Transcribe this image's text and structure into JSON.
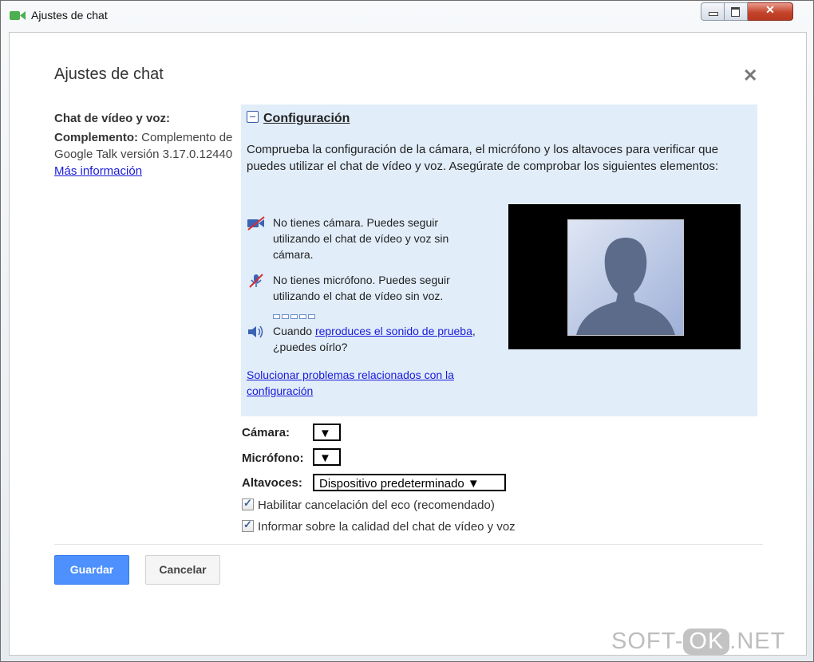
{
  "window": {
    "title": "Ajustes de chat",
    "icon": "video-camera-icon",
    "accent": "#4caf50"
  },
  "dialog": {
    "title": "Ajustes de chat",
    "close_icon": "close-icon"
  },
  "left": {
    "heading": "Chat de vídeo y voz:",
    "plugin_label": "Complemento:",
    "plugin_text": "Complemento de Google Talk versión 3.17.0.12440",
    "more_info_link": "Más información"
  },
  "config": {
    "header": "Configuración",
    "intro": "Comprueba la configuración de la cámara, el micrófono y los altavoces para verificar que puedes utilizar el chat de vídeo y voz. Asegúrate de comprobar los siguientes elementos:",
    "no_camera": "No tienes cámara. Puedes seguir utilizando el chat de vídeo y voz sin cámara.",
    "no_mic": "No tienes micrófono. Puedes seguir utilizando el chat de vídeo sin voz.",
    "sound_before": "Cuando ",
    "sound_link": "reproduces el sonido de prueba",
    "sound_after": ", ¿puedes oírlo?",
    "troubleshoot_link": "Solucionar problemas relacionados con la configuración"
  },
  "devices": {
    "camera_label": "Cámara:",
    "camera_value": "▼",
    "mic_label": "Micrófono:",
    "mic_value": "▼",
    "speakers_label": "Altavoces:",
    "speakers_value": "Dispositivo predeterminado ▼"
  },
  "options": {
    "echo_cancel": {
      "label": "Habilitar cancelación del eco (recomendado)",
      "checked": true
    },
    "quality_report": {
      "label": "Informar sobre la calidad del chat de vídeo y voz",
      "checked": true
    }
  },
  "buttons": {
    "save": "Guardar",
    "cancel": "Cancelar"
  },
  "watermark": {
    "left": "SOFT-",
    "badge": "OK",
    "right": ".NET"
  }
}
